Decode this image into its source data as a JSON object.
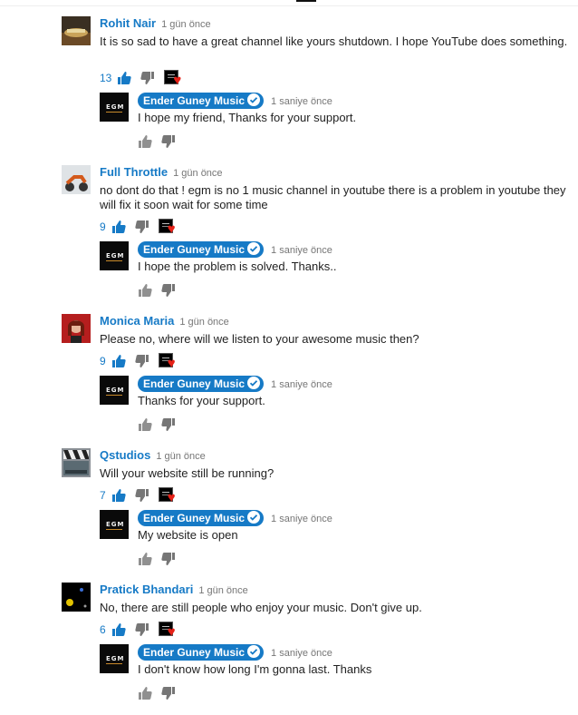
{
  "colors": {
    "author_blue": "#167ac6",
    "heart_red": "#e62117"
  },
  "icons": {
    "like": "thumbs-up-icon",
    "dislike": "thumbs-down-icon",
    "heart": "creator-heart-icon",
    "verified": "verified-check-icon"
  },
  "threads": [
    {
      "author": "Rohit Nair",
      "time": "1 gün önce",
      "text": "It is so sad to have a great channel like yours shutdown. I hope YouTube does something.",
      "likes": "13",
      "reply": {
        "author": "Ender Guney Music",
        "time": "1 saniye önce",
        "text": "I hope my friend, Thanks for your support."
      }
    },
    {
      "author": "Full Throttle",
      "time": "1 gün önce",
      "text": "no dont do that ! egm is no 1 music channel in youtube there is a problem in youtube  they will fix it soon wait for some time",
      "likes": "9",
      "reply": {
        "author": "Ender Guney Music",
        "time": "1 saniye önce",
        "text": "I hope the problem is solved. Thanks.."
      }
    },
    {
      "author": "Monica Maria",
      "time": "1 gün önce",
      "text": "Please no, where will we listen to your awesome music then?",
      "likes": "9",
      "reply": {
        "author": "Ender Guney Music",
        "time": "1 saniye önce",
        "text": "Thanks for your support."
      }
    },
    {
      "author": "Qstudios",
      "time": "1 gün önce",
      "text": "Will your website still be running?",
      "likes": "7",
      "reply": {
        "author": "Ender Guney Music",
        "time": "1 saniye önce",
        "text": "My website is open"
      }
    },
    {
      "author": "Pratick Bhandari",
      "time": "1 gün önce",
      "text": "No, there are still people who enjoy your music. Don't give up.",
      "likes": "6",
      "reply": {
        "author": "Ender Guney Music",
        "time": "1 saniye önce",
        "text": "I don't know how long I'm gonna last. Thanks"
      }
    }
  ]
}
